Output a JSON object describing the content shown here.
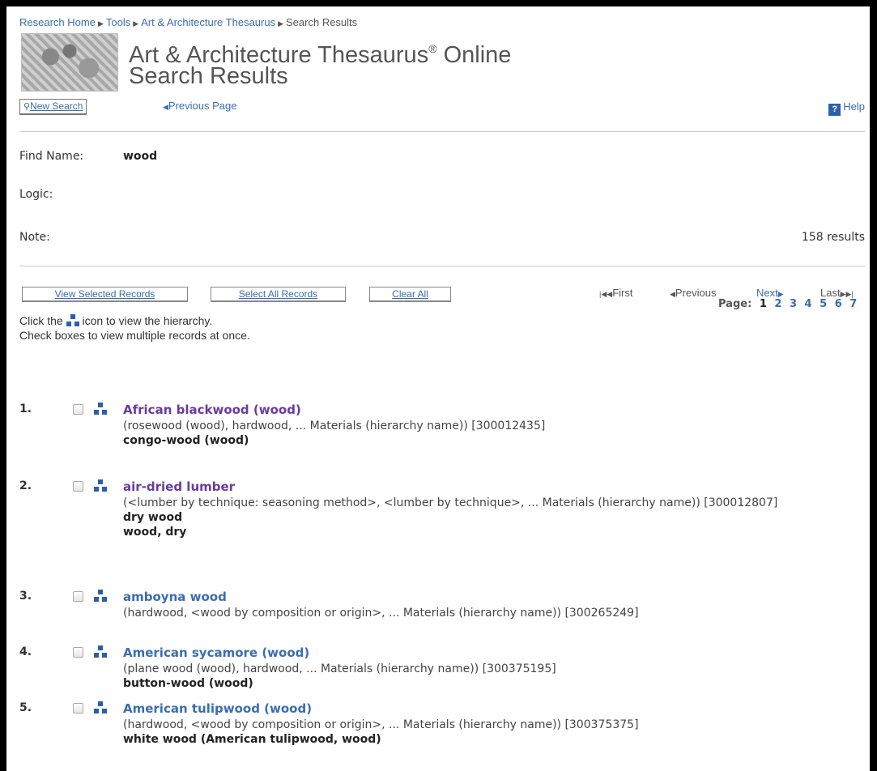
{
  "breadcrumb": {
    "items": [
      "Research Home",
      "Tools",
      "Art & Architecture Thesaurus"
    ],
    "current": "Search Results"
  },
  "header": {
    "title": "Art & Architecture Thesaurus",
    "title_mark": "®",
    "title_suffix": " Online",
    "subtitle": "Search Results"
  },
  "toolbar": {
    "new_search": "New Search",
    "previous_page": "Previous Page",
    "help": "Help"
  },
  "query": {
    "find_name_label": "Find Name:",
    "find_name_value": "wood",
    "logic_label": "Logic:",
    "note_label": "Note:",
    "results_count": "158 results"
  },
  "actions": {
    "view_selected": "View Selected Records",
    "select_all": "Select All Records",
    "clear_all": "Clear All"
  },
  "pager": {
    "first": "First",
    "previous": "Previous",
    "next": "Next",
    "last": "Last",
    "page_label": "Page:",
    "current": "1",
    "pages": [
      "2",
      "3",
      "4",
      "5",
      "6",
      "7"
    ]
  },
  "instructions": {
    "line1_before": "Click the",
    "line1_after": "icon to view the hierarchy.",
    "line2": "Check boxes to view multiple records at once."
  },
  "records": [
    {
      "num": "1.",
      "term": "African blackwood (wood)",
      "visited": true,
      "context": "(rosewood (wood), hardwood, ... Materials (hierarchy name)) [300012435]",
      "alts": [
        "congo-wood (wood)"
      ]
    },
    {
      "num": "2.",
      "term": "air-dried lumber",
      "visited": true,
      "context": "(<lumber by technique: seasoning method>, <lumber by technique>, ... Materials (hierarchy name)) [300012807]",
      "alts": [
        "dry wood",
        "wood, dry"
      ]
    },
    {
      "num": "3.",
      "term": "amboyna wood",
      "visited": false,
      "context": "(hardwood, <wood by composition or origin>, ... Materials (hierarchy name)) [300265249]",
      "alts": []
    },
    {
      "num": "4.",
      "term": "American sycamore (wood)",
      "visited": false,
      "context": "(plane wood (wood), hardwood, ... Materials (hierarchy name)) [300375195]",
      "alts": [
        "button-wood (wood)"
      ]
    },
    {
      "num": "5.",
      "term": "American tulipwood (wood)",
      "visited": false,
      "context": "(hardwood, <wood by composition or origin>, ... Materials (hierarchy name)) [300375375]",
      "alts": [
        "white wood (American tulipwood, wood)"
      ]
    }
  ]
}
